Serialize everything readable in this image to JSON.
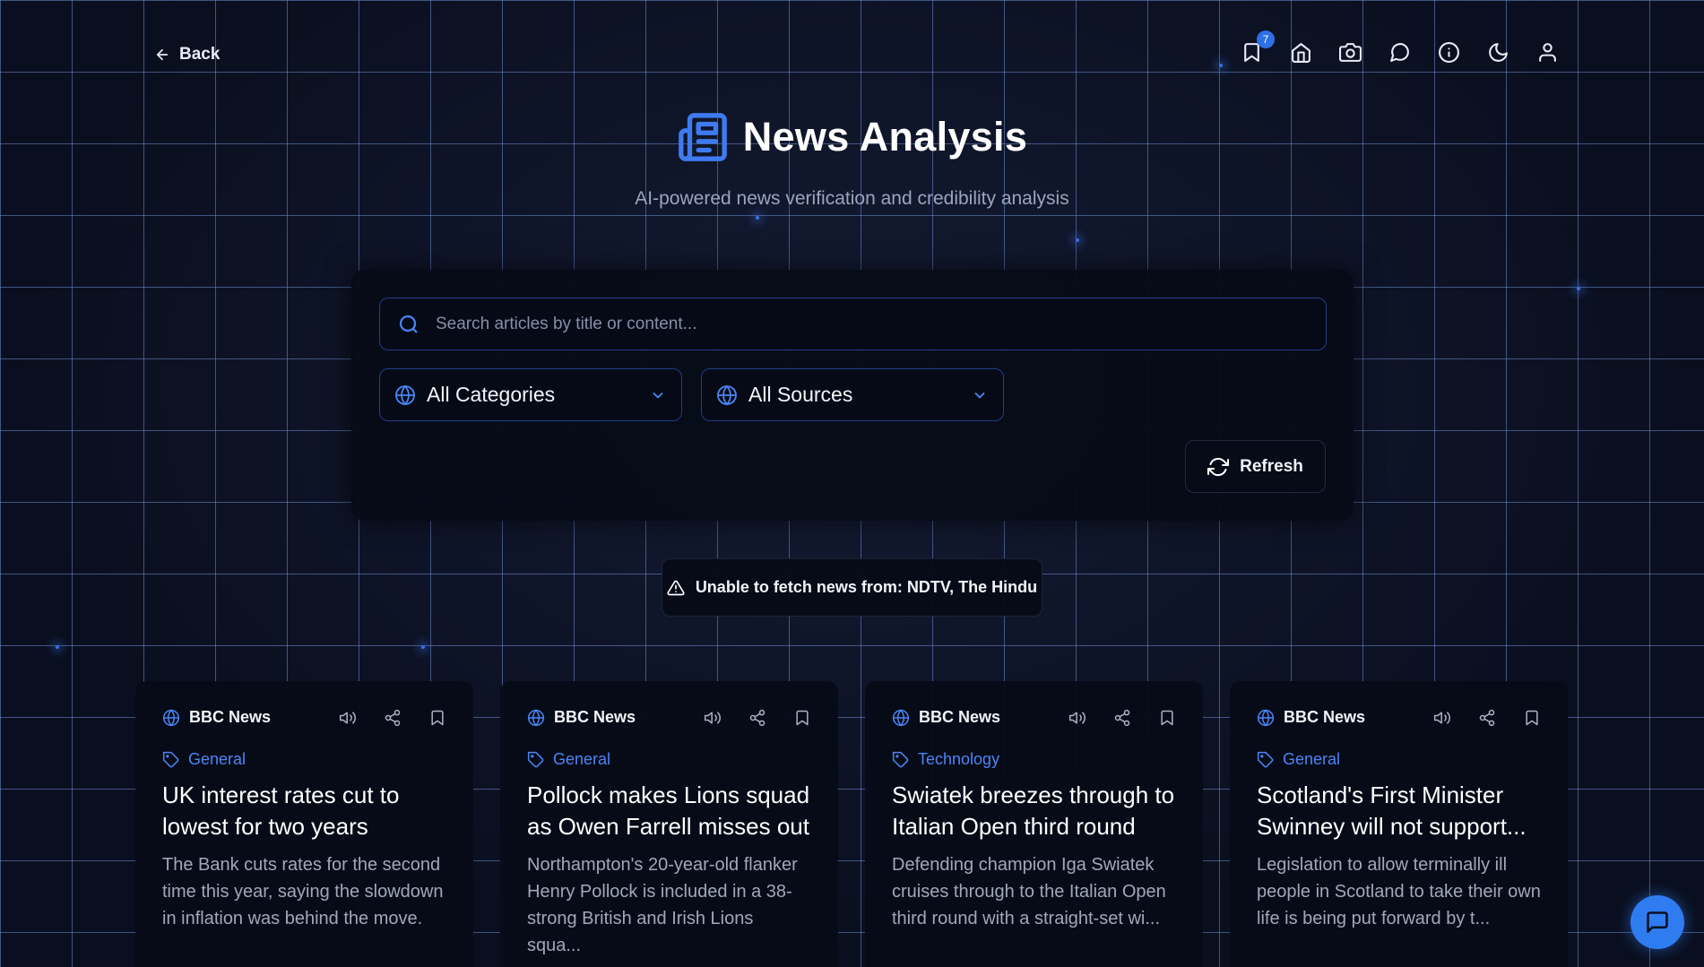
{
  "nav": {
    "back_label": "Back",
    "bookmark_count": "7",
    "icons": [
      "bookmark-icon",
      "home-icon",
      "camera-icon",
      "chat-icon",
      "info-icon",
      "moon-icon",
      "user-icon"
    ]
  },
  "header": {
    "title": "News Analysis",
    "subtitle": "AI-powered news verification and credibility analysis"
  },
  "search": {
    "placeholder": "Search articles by title or content...",
    "value": ""
  },
  "filters": {
    "category": "All Categories",
    "source": "All Sources",
    "refresh_label": "Refresh"
  },
  "alert": {
    "text": "Unable to fetch news from: NDTV, The Hindu"
  },
  "articles": [
    {
      "source": "BBC News",
      "category": "General",
      "title": "UK interest rates cut to lowest for two years",
      "summary": "The Bank cuts rates for the second time this year, saying the slowdown in inflation was behind the move."
    },
    {
      "source": "BBC News",
      "category": "General",
      "title": "Pollock makes Lions squad as Owen Farrell misses out",
      "summary": "Northampton's 20-year-old flanker Henry Pollock is included in a 38-strong British and Irish Lions squa..."
    },
    {
      "source": "BBC News",
      "category": "Technology",
      "title": "Swiatek breezes through to Italian Open third round",
      "summary": "Defending champion Iga Swiatek cruises through to the Italian Open third round with a straight-set wi..."
    },
    {
      "source": "BBC News",
      "category": "General",
      "title": "Scotland's First Minister Swinney will not support...",
      "summary": "Legislation to allow terminally ill people in Scotland to take their own life is being put forward by t..."
    }
  ],
  "colors": {
    "accent": "#3f7bf0",
    "background": "#0c1224",
    "panel": "#070b18"
  }
}
